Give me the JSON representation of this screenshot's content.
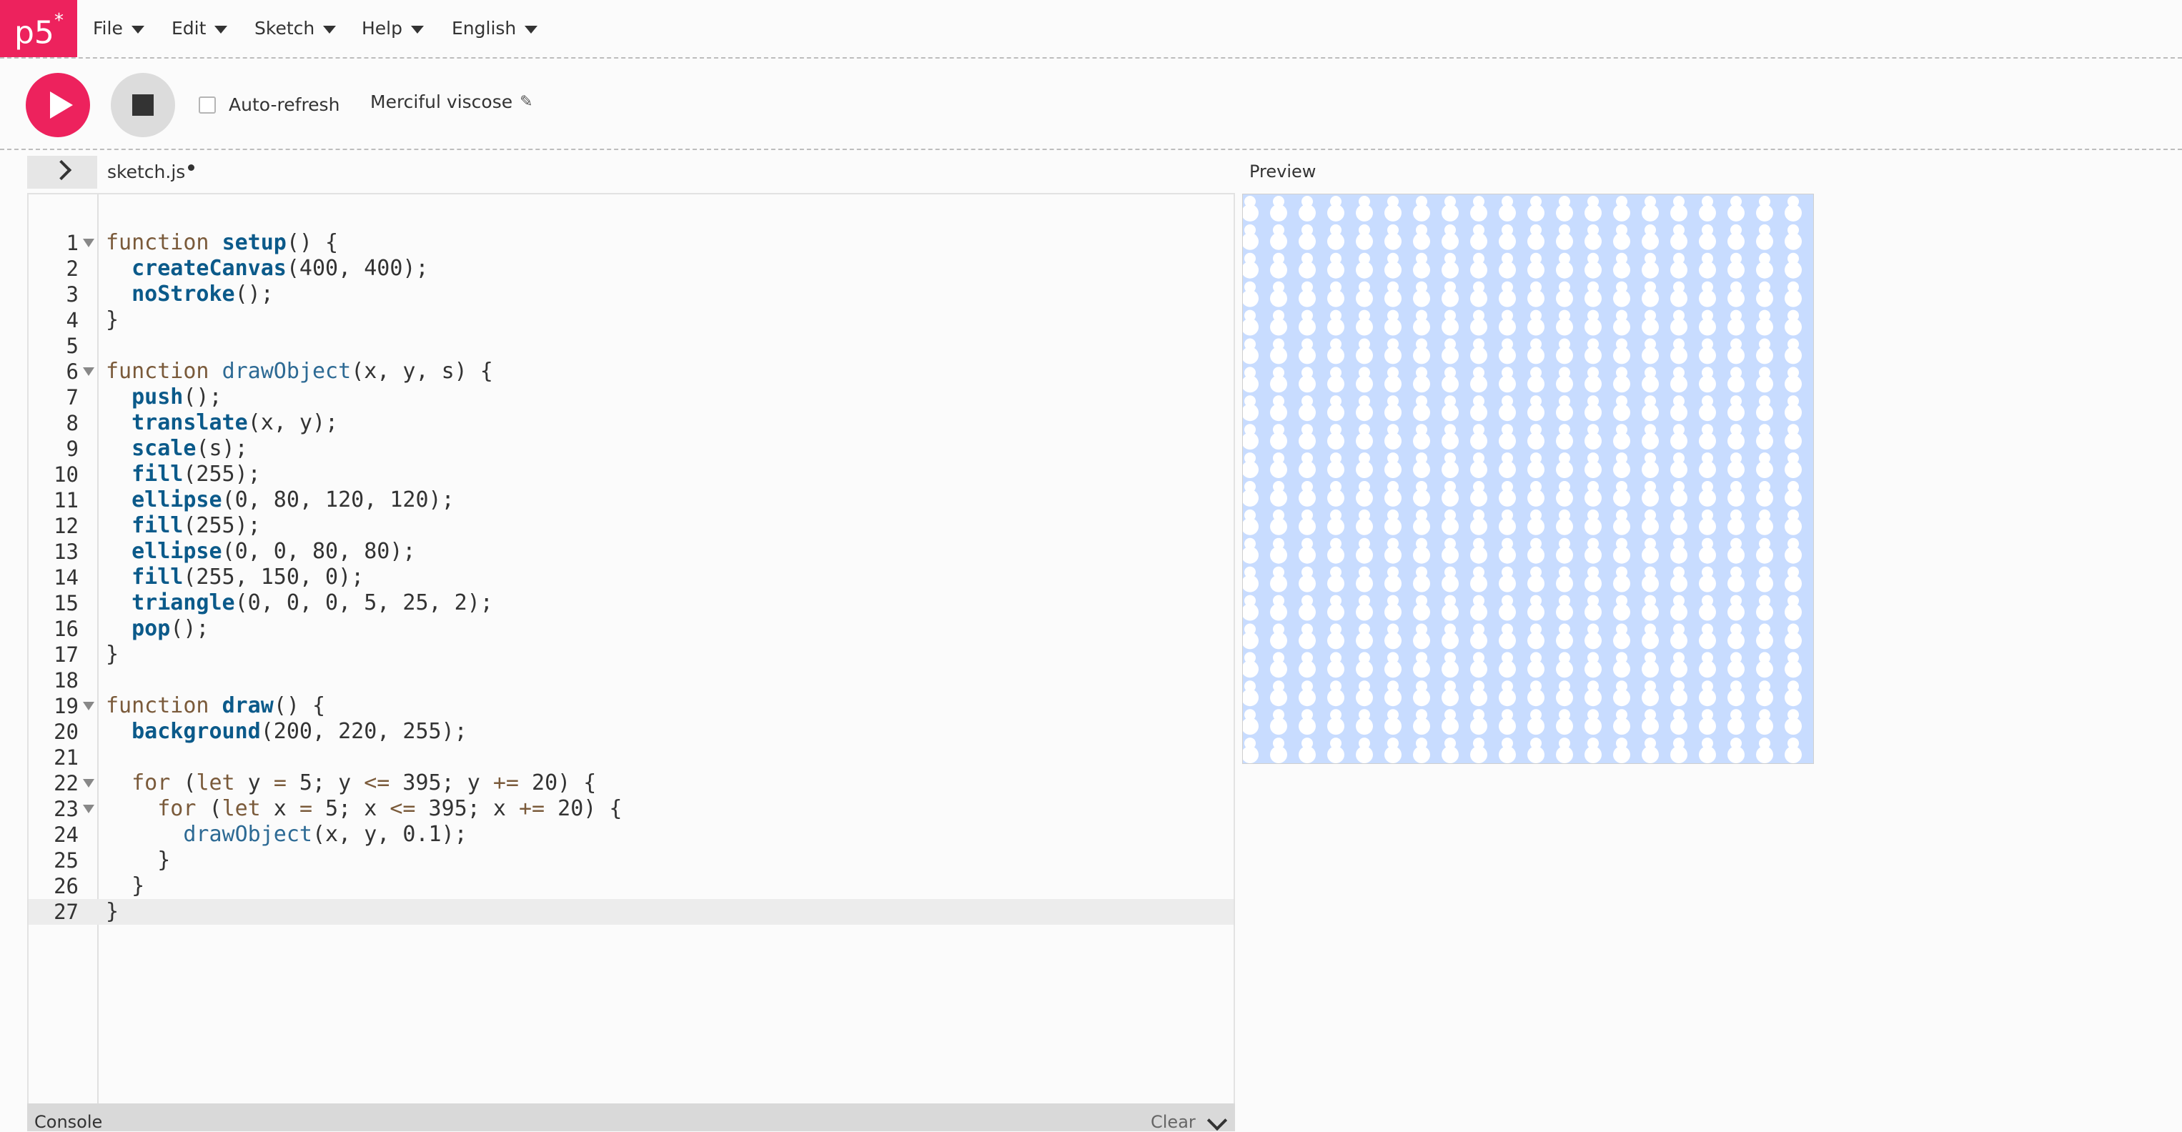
{
  "app": {
    "logo_text": "p5",
    "logo_star": "*"
  },
  "menu": {
    "items": [
      {
        "label": "File"
      },
      {
        "label": "Edit"
      },
      {
        "label": "Sketch"
      },
      {
        "label": "Help"
      },
      {
        "label": "English"
      }
    ]
  },
  "toolbar": {
    "auto_refresh_label": "Auto-refresh",
    "auto_refresh_checked": false,
    "sketch_name": "Merciful viscose",
    "icons": {
      "play": "play-icon",
      "stop": "stop-icon",
      "edit": "pencil-icon"
    }
  },
  "editor": {
    "file_name": "sketch.js",
    "unsaved": true,
    "active_line": 27,
    "lines": [
      "function setup() {",
      "  createCanvas(400, 400);",
      "  noStroke();",
      "}",
      "",
      "function drawObject(x, y, s) {",
      "  push();",
      "  translate(x, y);",
      "  scale(s);",
      "  fill(255);",
      "  ellipse(0, 80, 120, 120);",
      "  fill(255);",
      "  ellipse(0, 0, 80, 80);",
      "  fill(255, 150, 0);",
      "  triangle(0, 0, 0, 5, 25, 2);",
      "  pop();",
      "}",
      "",
      "function draw() {",
      "  background(200, 220, 255);",
      "",
      "  for (let y = 5; y <= 395; y += 20) {",
      "    for (let x = 5; x <= 395; x += 20) {",
      "      drawObject(x, y, 0.1);",
      "    }",
      "  }",
      "}"
    ],
    "fold_lines": [
      1,
      6,
      19,
      22,
      23
    ]
  },
  "console": {
    "title": "Console",
    "clear_label": "Clear"
  },
  "preview": {
    "label": "Preview",
    "background_color": "#c8dcff",
    "object_color": "#ffffff",
    "sketch_size": 400,
    "grid_start": 5,
    "grid_end": 395,
    "grid_step": 20,
    "scale": 0.1
  }
}
